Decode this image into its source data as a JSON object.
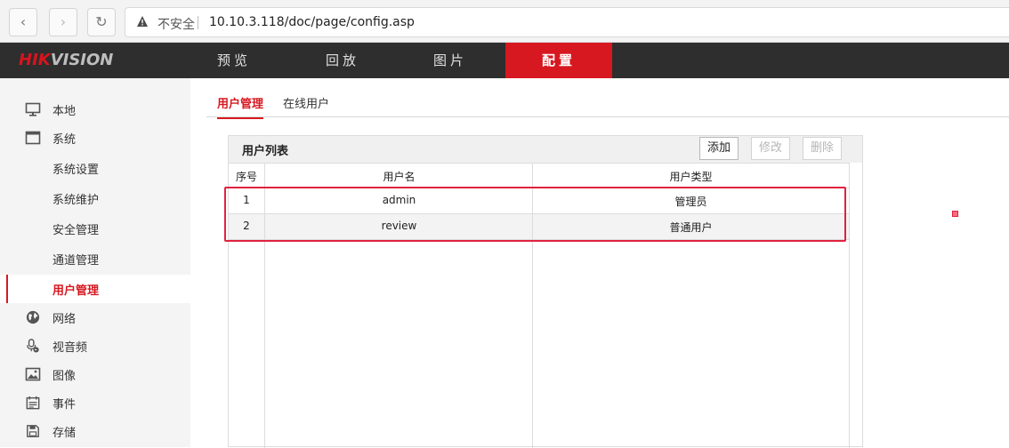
{
  "browser": {
    "security_label": "不安全",
    "url": "10.10.3.118/doc/page/config.asp"
  },
  "logo": {
    "part1": "HIK",
    "part2": "VISION"
  },
  "topnav": {
    "items": [
      {
        "label": "预览"
      },
      {
        "label": "回放"
      },
      {
        "label": "图片"
      },
      {
        "label": "配置"
      }
    ],
    "active_index": 3
  },
  "sidebar": {
    "items": [
      {
        "label": "本地",
        "icon": "monitor-icon"
      },
      {
        "label": "系统",
        "icon": "window-icon"
      },
      {
        "label": "系统设置"
      },
      {
        "label": "系统维护"
      },
      {
        "label": "安全管理"
      },
      {
        "label": "通道管理"
      },
      {
        "label": "用户管理"
      },
      {
        "label": "网络",
        "icon": "globe-icon"
      },
      {
        "label": "视音频",
        "icon": "microphone-icon"
      },
      {
        "label": "图像",
        "icon": "image-icon"
      },
      {
        "label": "事件",
        "icon": "calendar-icon"
      },
      {
        "label": "存储",
        "icon": "save-icon"
      }
    ],
    "active_label": "用户管理"
  },
  "tabs": [
    {
      "label": "用户管理"
    },
    {
      "label": "在线用户"
    }
  ],
  "panel": {
    "title": "用户列表",
    "add_label": "添加",
    "edit_label": "修改",
    "delete_label": "删除"
  },
  "table": {
    "headers": [
      "序号",
      "用户名",
      "用户类型"
    ],
    "rows": [
      {
        "index": "1",
        "username": "admin",
        "type": "管理员"
      },
      {
        "index": "2",
        "username": "review",
        "type": "普通用户"
      }
    ]
  },
  "colors": {
    "accent": "#d71820",
    "highlight": "#e0223e"
  }
}
